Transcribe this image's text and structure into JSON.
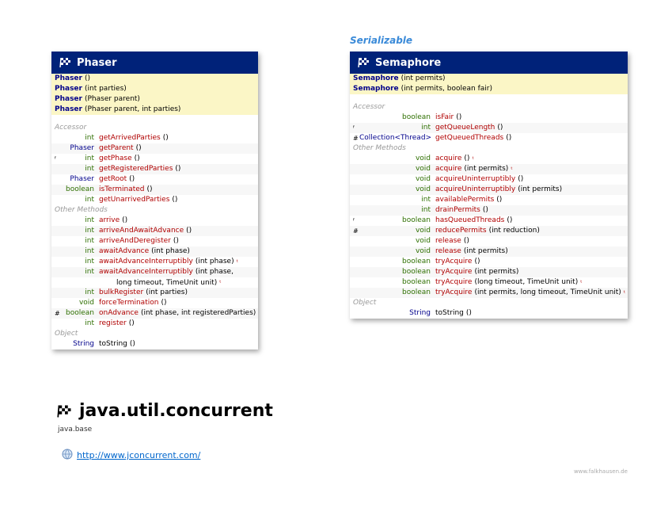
{
  "serializable": "Serializable",
  "phaser": {
    "title": "Phaser",
    "ctors": [
      {
        "name": "Phaser",
        "params": "()"
      },
      {
        "name": "Phaser",
        "params": "(int parties)"
      },
      {
        "name": "Phaser",
        "params": "(Phaser parent)"
      },
      {
        "name": "Phaser",
        "params": "(Phaser parent, int parties)"
      }
    ],
    "accessor_label": "Accessor",
    "accessors": [
      {
        "mod": "",
        "ret": "int",
        "name": "getArrivedParties",
        "params": "()"
      },
      {
        "mod": "",
        "ret": "Phaser",
        "name": "getParent",
        "params": "()"
      },
      {
        "mod": "ᶠ",
        "ret": "int",
        "name": "getPhase",
        "params": "()"
      },
      {
        "mod": "",
        "ret": "int",
        "name": "getRegisteredParties",
        "params": "()"
      },
      {
        "mod": "",
        "ret": "Phaser",
        "name": "getRoot",
        "params": "()"
      },
      {
        "mod": "",
        "ret": "boolean",
        "name": "isTerminated",
        "params": "()"
      },
      {
        "mod": "",
        "ret": "int",
        "name": "getUnarrivedParties",
        "params": "()"
      }
    ],
    "other_label": "Other Methods",
    "others": [
      {
        "mod": "",
        "ret": "int",
        "name": "arrive",
        "params": "()"
      },
      {
        "mod": "",
        "ret": "int",
        "name": "arriveAndAwaitAdvance",
        "params": "()"
      },
      {
        "mod": "",
        "ret": "int",
        "name": "arriveAndDeregister",
        "params": "()"
      },
      {
        "mod": "",
        "ret": "int",
        "name": "awaitAdvance",
        "params": "(int phase)"
      },
      {
        "mod": "",
        "ret": "int",
        "name": "awaitAdvanceInterruptibly",
        "params": "(int phase)",
        "ex": "ᵗ"
      },
      {
        "mod": "",
        "ret": "int",
        "name": "awaitAdvanceInterruptibly",
        "params": "(int phase,"
      },
      {
        "mod": "",
        "ret": "int",
        "name": "bulkRegister",
        "params": "(int parties)"
      },
      {
        "mod": "",
        "ret": "void",
        "name": "forceTermination",
        "params": "()"
      },
      {
        "mod": "#",
        "ret": "boolean",
        "name": "onAdvance",
        "params": "(int phase, int registeredParties)"
      },
      {
        "mod": "",
        "ret": "int",
        "name": "register",
        "params": "()"
      }
    ],
    "cont_line": "long timeout, TimeUnit unit)",
    "object_label": "Object",
    "object": {
      "ret": "String",
      "name": "toString",
      "params": "()"
    }
  },
  "semaphore": {
    "title": "Semaphore",
    "ctors": [
      {
        "name": "Semaphore",
        "params": "(int permits)"
      },
      {
        "name": "Semaphore",
        "params": "(int permits, boolean fair)"
      }
    ],
    "accessor_label": "Accessor",
    "accessors": [
      {
        "mod": "",
        "ret": "boolean",
        "name": "isFair",
        "params": "()"
      },
      {
        "mod": "ᶠ",
        "ret": "int",
        "name": "getQueueLength",
        "params": "()"
      },
      {
        "mod": "#",
        "ret": "Collection<Thread>",
        "name": "getQueuedThreads",
        "params": "()"
      }
    ],
    "other_label": "Other Methods",
    "others": [
      {
        "mod": "",
        "ret": "void",
        "name": "acquire",
        "params": "()",
        "ex": "ᵗ"
      },
      {
        "mod": "",
        "ret": "void",
        "name": "acquire",
        "params": "(int permits)",
        "ex": "ᵗ"
      },
      {
        "mod": "",
        "ret": "void",
        "name": "acquireUninterruptibly",
        "params": "()"
      },
      {
        "mod": "",
        "ret": "void",
        "name": "acquireUninterruptibly",
        "params": "(int permits)"
      },
      {
        "mod": "",
        "ret": "int",
        "name": "availablePermits",
        "params": "()"
      },
      {
        "mod": "",
        "ret": "int",
        "name": "drainPermits",
        "params": "()"
      },
      {
        "mod": "ᶠ",
        "ret": "boolean",
        "name": "hasQueuedThreads",
        "params": "()"
      },
      {
        "mod": "#",
        "ret": "void",
        "name": "reducePermits",
        "params": "(int reduction)"
      },
      {
        "mod": "",
        "ret": "void",
        "name": "release",
        "params": "()"
      },
      {
        "mod": "",
        "ret": "void",
        "name": "release",
        "params": "(int permits)"
      },
      {
        "mod": "",
        "ret": "boolean",
        "name": "tryAcquire",
        "params": "()"
      },
      {
        "mod": "",
        "ret": "boolean",
        "name": "tryAcquire",
        "params": "(int permits)"
      },
      {
        "mod": "",
        "ret": "boolean",
        "name": "tryAcquire",
        "params": "(long timeout, TimeUnit unit)",
        "ex": "ᵗ"
      },
      {
        "mod": "",
        "ret": "boolean",
        "name": "tryAcquire",
        "params": "(int permits, long timeout, TimeUnit unit)",
        "ex": "ᵗ"
      }
    ],
    "object_label": "Object",
    "object": {
      "ret": "String",
      "name": "toString",
      "params": "()"
    }
  },
  "package": {
    "name": "java.util.concurrent",
    "module": "java.base",
    "link": "http://www.jconcurrent.com/"
  },
  "footer": "www.falkhausen.de",
  "icons": {
    "flag": "checkered-flag-icon",
    "globe": "globe-icon"
  },
  "colors": {
    "header": "#002279",
    "ctor_bg": "#fbf6c6",
    "method": "#b00000",
    "type": "#00008b",
    "primitive": "#2e6f00",
    "serializable": "#3a8ad8"
  }
}
